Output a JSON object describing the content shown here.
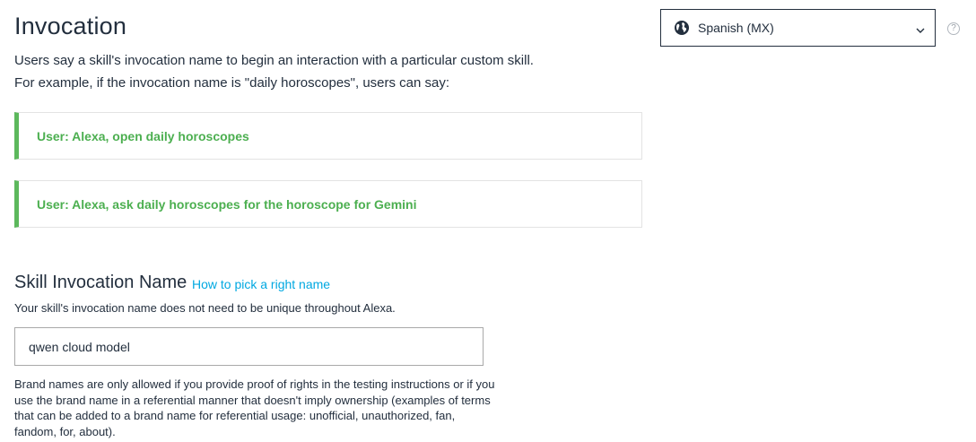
{
  "header": {
    "title": "Invocation",
    "description_line1": "Users say a skill's invocation name to begin an interaction with a particular custom skill.",
    "description_line2": "For example, if the invocation name is \"daily horoscopes\", users can say:"
  },
  "examples": [
    {
      "text": "User: Alexa, open daily horoscopes"
    },
    {
      "text": "User: Alexa, ask daily horoscopes for the horoscope for Gemini"
    }
  ],
  "language_select": {
    "selected": "Spanish (MX)",
    "icon": "globe-icon"
  },
  "help": {
    "icon_glyph": "?"
  },
  "invocation_name_section": {
    "title": "Skill Invocation Name",
    "help_link": "How to pick a right name",
    "description": "Your skill's invocation name does not need to be unique throughout Alexa.",
    "input_value": "qwen cloud model",
    "brand_note": "Brand names are only allowed if you provide proof of rights in the testing instructions or if you use the brand name in a referential manner that doesn't imply ownership (examples of terms that can be added to a brand name for referential usage: unofficial, unauthorized, fan, fandom, for, about)."
  },
  "colors": {
    "accent_green": "#5cb85c",
    "example_text": "#4caf50",
    "link": "#00a8e1",
    "text": "#232f3e"
  }
}
